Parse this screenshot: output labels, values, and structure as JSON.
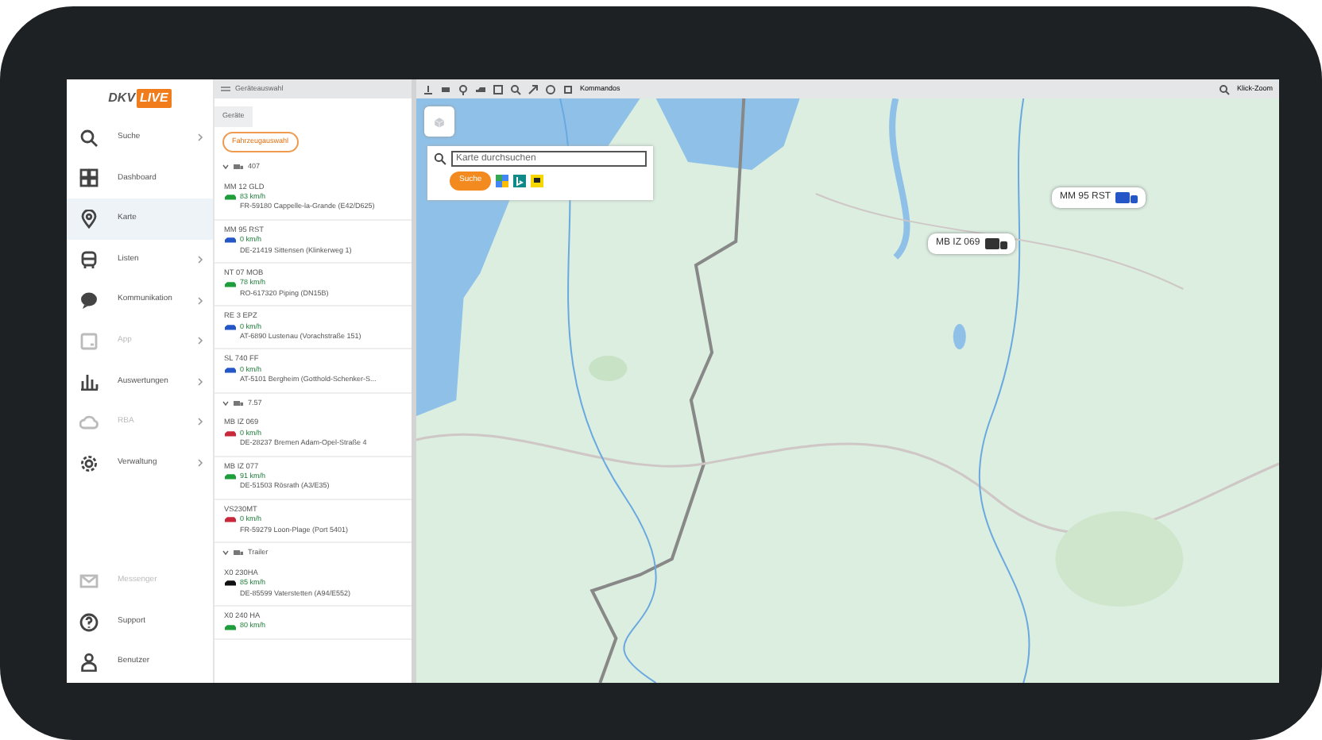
{
  "logo": {
    "part_1": "DKV",
    "part_2": "LIVE"
  },
  "sidebar": {
    "items": [
      {
        "label": "Suche",
        "selected": false,
        "disabled": false,
        "submenu": true
      },
      {
        "label": "Dashboard",
        "selected": false,
        "disabled": false,
        "submenu": false
      },
      {
        "label": "Karte",
        "selected": true,
        "disabled": false,
        "submenu": false
      },
      {
        "label": "Listen",
        "selected": false,
        "disabled": false,
        "submenu": true
      },
      {
        "label": "Kommunikation",
        "selected": false,
        "disabled": false,
        "submenu": true
      },
      {
        "label": "App",
        "selected": false,
        "disabled": true,
        "submenu": true
      },
      {
        "label": "Auswertungen",
        "selected": false,
        "disabled": false,
        "submenu": true
      },
      {
        "label": "RBA",
        "selected": false,
        "disabled": true,
        "submenu": true
      },
      {
        "label": "Verwaltung",
        "selected": false,
        "disabled": false,
        "submenu": true
      }
    ],
    "bottom_items": [
      {
        "label": "Messenger",
        "disabled": true
      },
      {
        "label": "Support",
        "disabled": false
      },
      {
        "label": "Benutzer",
        "disabled": false
      }
    ]
  },
  "device_panel": {
    "title": "Geräteauswahl",
    "tabs": [
      {
        "label": "Geräte",
        "selected": true
      }
    ],
    "filter_button": "Fahrzeugauswahl",
    "groups": [
      {
        "name": "407",
        "expanded": true,
        "vehicles": [
          {
            "plate": "MM 12 GLD",
            "color": "#1e9e3a",
            "speed": "83 km/h",
            "location": "FR-59180 Cappelle-la-Grande (E42/D625)"
          },
          {
            "plate": "MM 95 RST",
            "color": "#2456c8",
            "speed": "0 km/h",
            "location": "DE-21419 Sittensen (Klinkerweg 1)"
          },
          {
            "plate": "NT 07 MOB",
            "color": "#1e9e3a",
            "speed": "78 km/h",
            "location": "RO-617320 Piping (DN15B)"
          },
          {
            "plate": "RE 3 EPZ",
            "color": "#2456c8",
            "speed": "0 km/h",
            "location": "AT-6890 Lustenau (Vorachstraße 151)"
          },
          {
            "plate": "SL 740 FF",
            "color": "#2456c8",
            "speed": "0 km/h",
            "location": "AT-5101 Bergheim (Gotthold-Schenker-S..."
          }
        ]
      },
      {
        "name": "7.57",
        "expanded": true,
        "vehicles": [
          {
            "plate": "MB IZ 069",
            "color": "#c8283a",
            "speed": "0 km/h",
            "location": "DE-28237 Bremen Adam-Opel-Straße 4"
          },
          {
            "plate": "MB IZ 077",
            "color": "#1e9e3a",
            "speed": "91 km/h",
            "location": "DE-51503 Rösrath (A3/E35)"
          },
          {
            "plate": "VS230MT",
            "color": "#c8283a",
            "speed": "0 km/h",
            "location": "FR-59279 Loon-Plage (Port 5401)"
          }
        ]
      },
      {
        "name": "Trailer",
        "expanded": true,
        "vehicles": [
          {
            "plate": "X0 230HA",
            "color": "#111111",
            "speed": "85 km/h",
            "location": "DE-85599 Vaterstetten (A94/E552)"
          },
          {
            "plate": "X0 240 HA",
            "color": "#1e9e3a",
            "speed": "80 km/h"
          }
        ]
      }
    ]
  },
  "map": {
    "toolbar": {
      "commands": "Kommandos",
      "click_zoom": "Klick-Zoom"
    },
    "search": {
      "placeholder": "Karte durchsuchen",
      "button": "Suche"
    },
    "markers": [
      {
        "label": "MM 95 RST",
        "color": "#2456c8"
      },
      {
        "label": "MB IZ 069",
        "color": "#333333"
      }
    ]
  }
}
